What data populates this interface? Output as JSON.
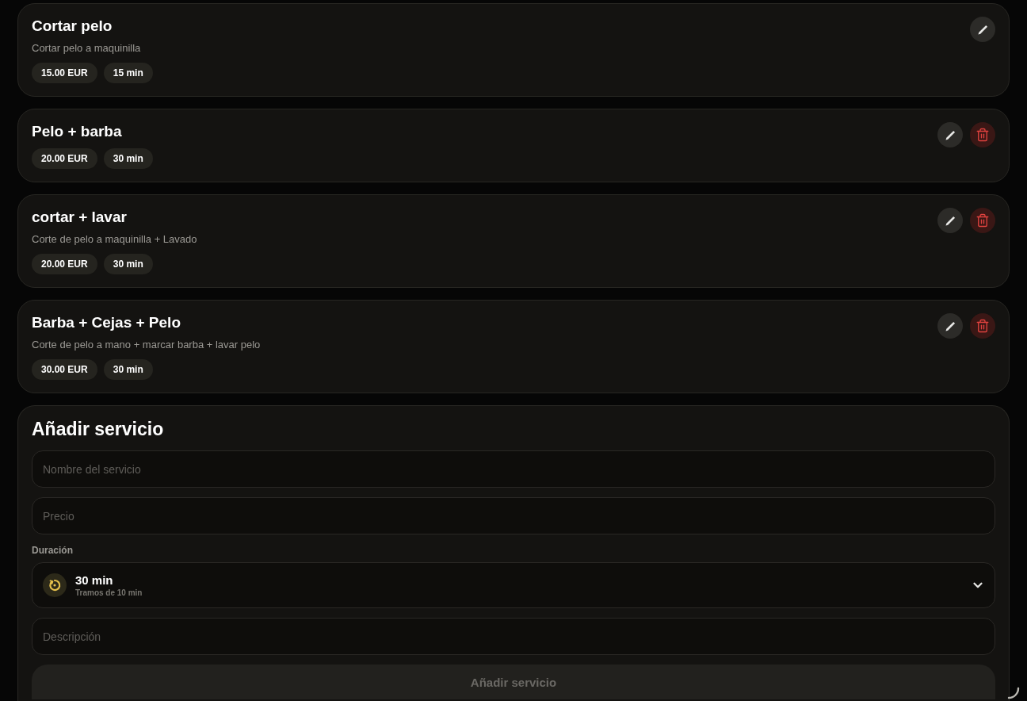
{
  "services": [
    {
      "name": "Cortar pelo",
      "description": "Cortar pelo a maquinilla",
      "price": "15.00 EUR",
      "duration": "15 min",
      "actions": [
        {
          "kind": "edit"
        }
      ]
    },
    {
      "name": "Pelo + barba",
      "price": "20.00 EUR",
      "duration": "30 min",
      "actions": [
        {
          "kind": "edit"
        },
        {
          "kind": "delete"
        }
      ]
    },
    {
      "name": "cortar + lavar",
      "description": "Corte de pelo a maquinilla + Lavado",
      "price": "20.00 EUR",
      "duration": "30 min",
      "actions": [
        {
          "kind": "edit"
        },
        {
          "kind": "delete"
        }
      ]
    },
    {
      "name": "Barba + Cejas + Pelo",
      "description": "Corte de pelo a mano + marcar barba + lavar pelo",
      "price": "30.00 EUR",
      "duration": "30 min",
      "actions": [
        {
          "kind": "edit"
        },
        {
          "kind": "delete"
        }
      ]
    }
  ],
  "form": {
    "title": "Añadir servicio",
    "fields": [
      {
        "kind": "text",
        "placeholder": "Nombre del servicio"
      },
      {
        "kind": "text",
        "placeholder": "Precio"
      },
      {
        "kind": "select",
        "label": "Duración",
        "value": "30 min",
        "hint": "Tramos de 10 min"
      },
      {
        "kind": "text",
        "placeholder": "Descripción"
      }
    ],
    "submit": {
      "label": "Añadir servicio",
      "disabled": true
    }
  }
}
